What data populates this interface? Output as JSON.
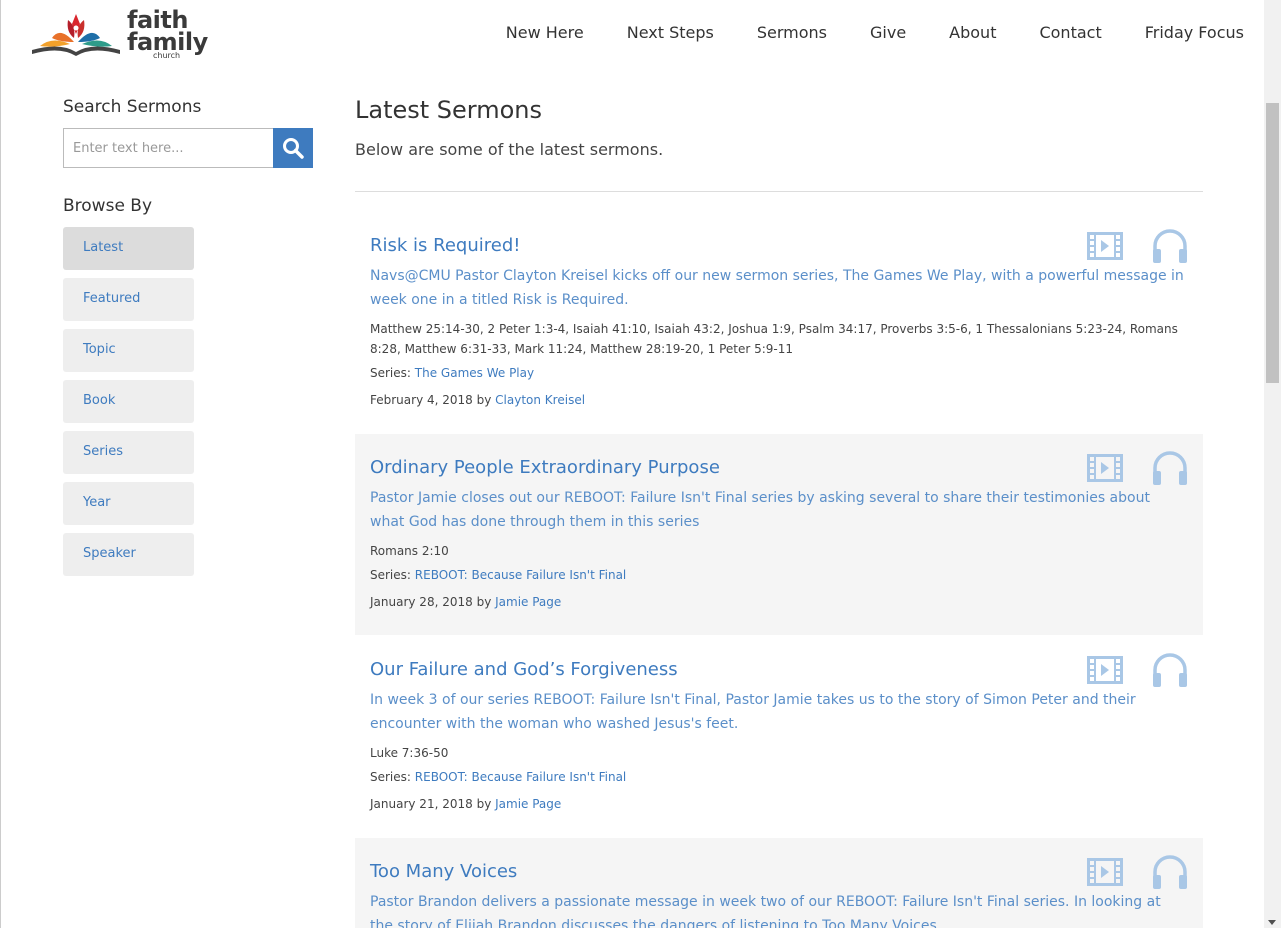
{
  "brand": {
    "line1": "faith",
    "line2": "family",
    "line3": "church"
  },
  "nav": [
    "New Here",
    "Next Steps",
    "Sermons",
    "Give",
    "About",
    "Contact",
    "Friday Focus"
  ],
  "sidebar": {
    "search_title": "Search Sermons",
    "search_placeholder": "Enter text here...",
    "browse_title": "Browse By",
    "browse_items": [
      "Latest",
      "Featured",
      "Topic",
      "Book",
      "Series",
      "Year",
      "Speaker"
    ],
    "active_item": "Latest"
  },
  "main": {
    "title": "Latest Sermons",
    "subtitle": "Below are some of the latest sermons."
  },
  "sermons": [
    {
      "title": "Risk is Required!",
      "description": "Navs@CMU Pastor Clayton Kreisel kicks off our new sermon series, The Games We Play, with a powerful message in week one in a titled Risk is Required.",
      "scripture": "Matthew 25:14-30, 2 Peter 1:3-4, Isaiah 41:10, Isaiah 43:2, Joshua 1:9, Psalm 34:17, Proverbs 3:5-6, 1 Thessalonians 5:23-24, Romans 8:28, Matthew 6:31-33, Mark 11:24, Matthew 28:19-20, 1 Peter 5:9-11",
      "series_label": "Series:",
      "series": "The Games We Play",
      "date": "February 4, 2018",
      "by": "by",
      "speaker": "Clayton Kreisel"
    },
    {
      "title": "Ordinary People Extraordinary Purpose",
      "description": "Pastor Jamie closes out our REBOOT: Failure Isn't Final series by asking several to share their testimonies about what God has done through them in this series",
      "scripture": "Romans 2:10",
      "series_label": "Series:",
      "series": "REBOOT: Because Failure Isn't Final",
      "date": "January 28, 2018",
      "by": "by",
      "speaker": "Jamie Page"
    },
    {
      "title": "Our Failure and God’s Forgiveness",
      "description": "In week 3 of our series REBOOT: Failure Isn't Final, Pastor Jamie takes us to the story of Simon Peter and their encounter with the woman who washed Jesus's feet.",
      "scripture": "Luke 7:36-50",
      "series_label": "Series:",
      "series": "REBOOT: Because Failure Isn't Final",
      "date": "January 21, 2018",
      "by": "by",
      "speaker": "Jamie Page"
    },
    {
      "title": "Too Many Voices",
      "description": "Pastor Brandon delivers a passionate message in week two of our REBOOT: Failure Isn't Final series. In looking at the story of Elijah Brandon discusses the dangers of listening to Too Many Voices",
      "scripture": "",
      "series_label": "",
      "series": "",
      "date": "",
      "by": "",
      "speaker": ""
    }
  ],
  "colors": {
    "accent": "#3e7bbf",
    "icon": "#a9c7e6"
  }
}
